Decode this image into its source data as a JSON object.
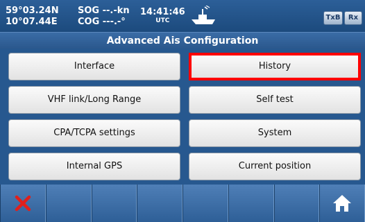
{
  "status": {
    "latitude": "59°03.24N",
    "longitude": "10°07.44E",
    "sog": "SOG --.-kn",
    "cog": "COG ---.-°",
    "time": "14:41:46",
    "time_zone": "UTC",
    "chip_txb": "TxB",
    "chip_rx": "Rx"
  },
  "page_title": "Advanced Ais Configuration",
  "menu": {
    "interface": "Interface",
    "history": "History",
    "vhf_link": "VHF link/Long Range",
    "self_test": "Self test",
    "cpa_tcpa": "CPA/TCPA settings",
    "system": "System",
    "internal_gps": "Internal GPS",
    "current_position": "Current position",
    "selected": "History"
  },
  "colors": {
    "selection_border": "#ff0000",
    "close_icon": "#e0201c"
  },
  "toolbar": {
    "left_icon": "close-icon",
    "right_icon": "home-icon"
  }
}
